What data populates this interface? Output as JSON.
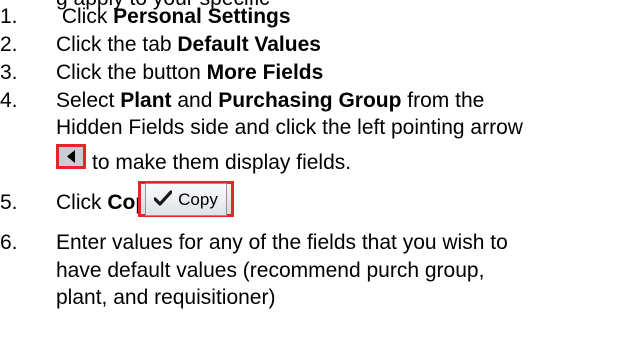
{
  "top_fragment": "g apply to your specific",
  "steps": [
    {
      "num": "1.",
      "pre": " Click ",
      "bold": "Personal Settings"
    },
    {
      "num": "2.",
      "pre": "Click the tab ",
      "bold": "Default Values"
    },
    {
      "num": "3.",
      "pre": "Click the button ",
      "bold": "More Fields"
    },
    {
      "num": "4.",
      "pre": "Select ",
      "bold1": "Plant",
      "mid": " and ",
      "bold2": "Purchasing Group",
      "post": " from the",
      "line2": "Hidden Fields side and click the left pointing arrow",
      "line3": "to make them display fields.",
      "arrow_icon": "left-arrow-icon"
    },
    {
      "num": "5.",
      "pre": "Click ",
      "bold": "Copy",
      "button_label": "Copy",
      "button_icon": "checkmark-icon"
    },
    {
      "num": "6.",
      "line1": "Enter values for any of the fields that you wish to",
      "line2": "have default values (recommend purch group,",
      "line3": "plant, and requisitioner)"
    }
  ],
  "colors": {
    "highlight": "#e3262a",
    "arrow_bg": "#c9ccd2"
  }
}
